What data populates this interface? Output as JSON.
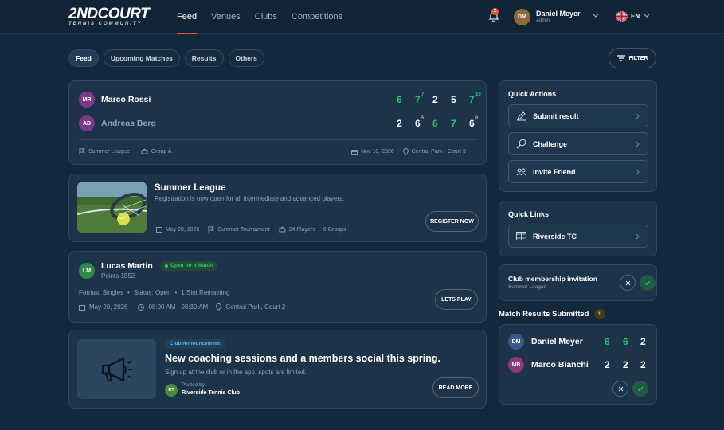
{
  "app": {
    "logo_main": "2NDCOURT",
    "logo_sub": "TENNIS COMMUNITY"
  },
  "nav": [
    {
      "label": "Feed",
      "active": true
    },
    {
      "label": "Venues",
      "active": false
    },
    {
      "label": "Clubs",
      "active": false
    },
    {
      "label": "Competitions",
      "active": false
    }
  ],
  "header": {
    "notifications_count": "2",
    "user_initials": "DM",
    "user_name": "Daniel Meyer",
    "user_role": "Admin",
    "language": "EN"
  },
  "feed_tabs": [
    "Feed",
    "Upcoming Matches",
    "Results",
    "Others"
  ],
  "filter_label": "FILTER",
  "match_card": {
    "player1": {
      "initials": "MR",
      "name": "Marco Rossi",
      "sets": [
        "6",
        "7",
        "2",
        "5",
        "7"
      ],
      "tiebreaks": [
        "",
        "7",
        "",
        "",
        "10"
      ]
    },
    "player2": {
      "initials": "AB",
      "name": "Andreas Berg",
      "sets": [
        "2",
        "6",
        "6",
        "7",
        "6"
      ],
      "tiebreaks": [
        "",
        "5",
        "",
        "",
        "8"
      ]
    },
    "league": "Summer League",
    "group": "Group A",
    "date": "Nov 18, 2026",
    "location": "Central Park · Court 3"
  },
  "league_card": {
    "title": "Summer League",
    "description": "Registration is now open for all intermediate and advanced players.",
    "date": "May 20, 2026",
    "type": "Summer Tournament",
    "players": "24 Players",
    "groups": "6 Groups",
    "button": "REGISTER NOW"
  },
  "open_match_card": {
    "initials": "LM",
    "name": "Lucas Martin",
    "badge": "Open for a Match",
    "points": "Points 1552",
    "format": "Format: Singles",
    "status": "Status: Open",
    "slots": "1 Slot Remaining",
    "date": "May 20, 2026",
    "time": "08:00 AM - 08:30 AM",
    "location": "Central Park, Court 2",
    "button": "LETS PLAY"
  },
  "announcement_card": {
    "tag": "Club Announcement",
    "title": "New coaching sessions and a members social this spring.",
    "subtitle": "Sign up at the club or in the app, spots are limited.",
    "posted_by_label": "Posted by",
    "poster_initials": "RT",
    "poster": "Riverside Tennis Club",
    "button": "READ MORE"
  },
  "quick_actions": {
    "title": "Quick Actions",
    "items": [
      {
        "label": "Submit result",
        "icon": "pencil-icon"
      },
      {
        "label": "Challenge",
        "icon": "racket-icon"
      },
      {
        "label": "Invite Friend",
        "icon": "group-icon"
      }
    ]
  },
  "quick_links": {
    "title": "Quick Links",
    "items": [
      {
        "label": "Riverside TC",
        "icon": "court-icon"
      }
    ]
  },
  "invitation": {
    "title": "Club membership invitation",
    "subtitle": "Summer League"
  },
  "results_submitted": {
    "title": "Match Results Submitted",
    "count": "1",
    "player1": {
      "initials": "DM",
      "name": "Daniel Meyer",
      "sets": [
        "6",
        "6",
        "2"
      ]
    },
    "player2": {
      "initials": "MB",
      "name": "Marco Bianchi",
      "sets": [
        "2",
        "2",
        "2"
      ]
    }
  },
  "colors": {
    "accent": "#e8542c",
    "win": "#2fc36b",
    "background": "#13283c",
    "card": "#1c3349"
  }
}
